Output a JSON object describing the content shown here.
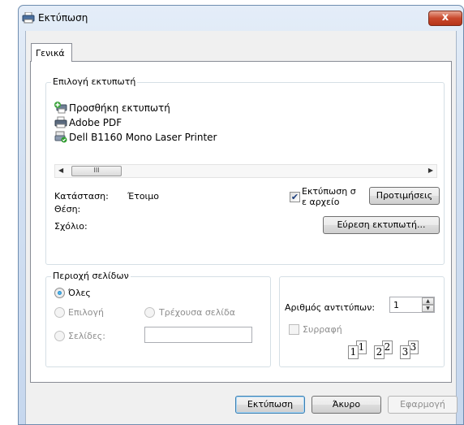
{
  "window": {
    "title": "Εκτύπωση",
    "close_label": "x"
  },
  "tabs": [
    {
      "label": "Γενικά"
    }
  ],
  "printer_selection": {
    "legend": "Επιλογή εκτυπωτή",
    "printers": [
      {
        "label": "Προσθήκη εκτυπωτή",
        "icon": "add-printer-icon"
      },
      {
        "label": "Adobe PDF",
        "icon": "printer-icon"
      },
      {
        "label": "Dell B1160 Mono Laser Printer",
        "icon": "default-printer-icon"
      }
    ],
    "scroll_thumb_glyph": "III",
    "status_label": "Κατάσταση:",
    "status_value": "Έτοιμο",
    "location_label": "Θέση:",
    "comment_label": "Σχόλιο:",
    "print_to_file_line1": "Εκτύπωση σ",
    "print_to_file_line2": "ε αρχείο",
    "print_to_file_checked": true,
    "preferences_label": "Προτιμήσεις",
    "find_printer_label": "Εύρεση εκτυπωτή..."
  },
  "page_range": {
    "legend": "Περιοχή σελίδων",
    "all_label": "Όλες",
    "selection_label": "Επιλογή",
    "current_page_label": "Τρέχουσα σελίδα",
    "pages_label": "Σελίδες:",
    "pages_value": "",
    "selected": "all"
  },
  "copies": {
    "count_label": "Αριθμός αντιτύπων:",
    "count_value": "1",
    "collate_label": "Συρραφή",
    "collate_checked": false,
    "collate_pages": [
      [
        "1",
        "1"
      ],
      [
        "2",
        "2"
      ],
      [
        "3",
        "3"
      ]
    ]
  },
  "footer": {
    "print_label": "Εκτύπωση",
    "cancel_label": "Άκυρο",
    "apply_label": "Εφαρμογή"
  }
}
